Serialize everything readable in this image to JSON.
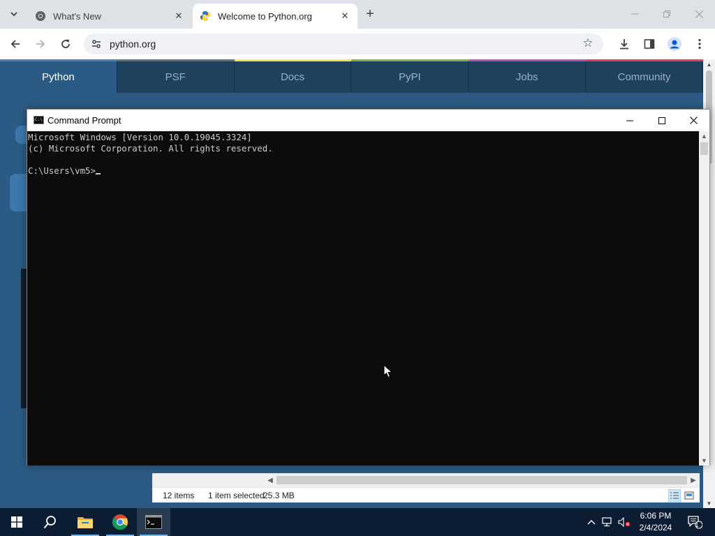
{
  "browser": {
    "tabs": [
      {
        "title": "What's New",
        "active": false,
        "icon": "chrome-icon"
      },
      {
        "title": "Welcome to Python.org",
        "active": true,
        "icon": "python-icon"
      }
    ],
    "new_tab_symbol": "+",
    "address": "python.org"
  },
  "python_nav": {
    "items": [
      "Python",
      "PSF",
      "Docs",
      "PyPI",
      "Jobs",
      "Community"
    ],
    "active": "Python",
    "accent_colors": [
      "#4584b6",
      "#646e79",
      "#ffde57",
      "#7ab648",
      "#b44fc4",
      "#e3405a"
    ]
  },
  "explorer": {
    "items_count": "12 items",
    "selection": "1 item selected",
    "size": "25.3 MB"
  },
  "cmd": {
    "title": "Command Prompt",
    "lines": [
      "Microsoft Windows [Version 10.0.19045.3324]",
      "(c) Microsoft Corporation. All rights reserved.",
      "",
      "C:\\Users\\vm5>"
    ]
  },
  "taskbar": {
    "apps": [
      "start-icon",
      "search-icon",
      "file-explorer-icon",
      "chrome-icon",
      "command-prompt-icon"
    ],
    "active_app": "command-prompt-icon",
    "time": "6:06 PM",
    "date": "2/4/2024",
    "notification_count": "1"
  },
  "colors": {
    "python_blue": "#2b5b84",
    "python_nav": "#1e415e",
    "console_bg": "#0c0c0c",
    "console_fg": "#cccccc",
    "taskbar": "#0c1d33"
  }
}
